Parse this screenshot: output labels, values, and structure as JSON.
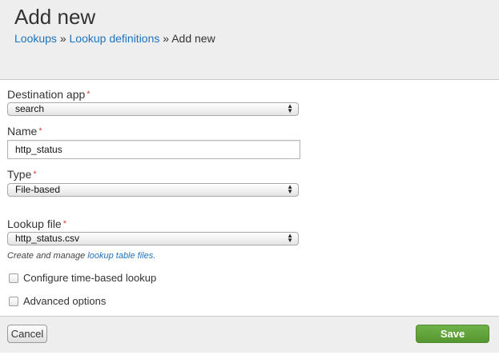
{
  "header": {
    "title": "Add new",
    "breadcrumb": [
      {
        "label": "Lookups"
      },
      {
        "label": "Lookup definitions"
      },
      {
        "label": "Add new"
      }
    ],
    "separator": "»"
  },
  "form": {
    "required_marker": "*",
    "destination_app": {
      "label": "Destination app",
      "value": "search"
    },
    "name": {
      "label": "Name",
      "value": "http_status"
    },
    "type": {
      "label": "Type",
      "value": "File-based"
    },
    "lookup_file": {
      "label": "Lookup file",
      "value": "http_status.csv",
      "help_text": "Create and manage",
      "help_link": "lookup table files."
    },
    "time_based": {
      "label": "Configure time-based lookup",
      "checked": false
    },
    "advanced": {
      "label": "Advanced options",
      "checked": false
    }
  },
  "footer": {
    "cancel_label": "Cancel",
    "save_label": "Save"
  },
  "colors": {
    "link": "#1e73be",
    "required": "#d6423a",
    "save_button": "#5fa23b"
  }
}
